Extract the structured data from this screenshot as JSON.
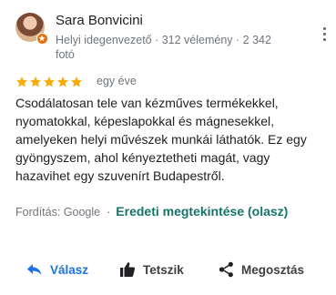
{
  "review": {
    "author": "Sara Bonvicini",
    "meta_line1": "Helyi idegenvezető · 312 vélemény · 2 342",
    "meta_line2": "fotó",
    "rating": 5,
    "star_color": "#f9ab00",
    "date": "egy éve",
    "text_lines": [
      "Csodálatosan tele van kézműves termékekkel,",
      "nyomatokkal, képeslapokkal és mágnesekkel,",
      "amelyeken helyi művészek munkái láthatók. Ez egy",
      "gyöngyszem, ahol kényeztetheti magát, vagy",
      "hazavihet egy szuvenírt Budapestről."
    ],
    "translation_label": "Fordítás: Google",
    "translation_separator": "·",
    "original_link": "Eredeti megtekintése (olasz)"
  },
  "actions": {
    "reply_label": "Válasz",
    "like_label": "Tetszik",
    "share_label": "Megosztás"
  },
  "icons": {
    "avatar": "avatar",
    "local_guide_badge": "local-guide-badge-icon",
    "more": "more-vertical-icon",
    "reply": "reply-arrow-icon",
    "like": "thumbs-up-icon",
    "share": "share-icon"
  },
  "colors": {
    "accent_blue": "#1a73e8",
    "link_teal": "#15756b",
    "badge_orange": "#e8710a"
  }
}
